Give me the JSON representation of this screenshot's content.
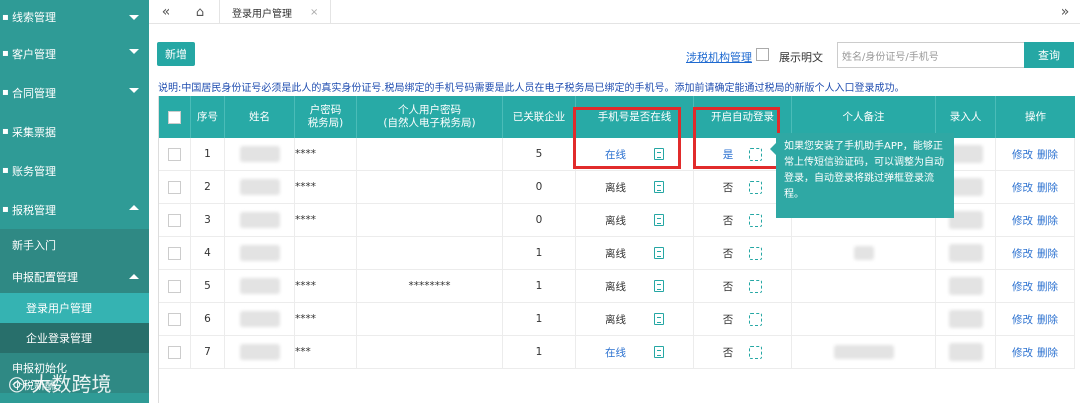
{
  "sidebar": {
    "items": [
      {
        "label": "线索管理",
        "icon": "folder-icon"
      },
      {
        "label": "客户管理",
        "icon": "user-icon"
      },
      {
        "label": "合同管理",
        "icon": "contract-icon"
      },
      {
        "label": "采集票据",
        "icon": "receipt-icon"
      },
      {
        "label": "账务管理",
        "icon": "ledger-icon"
      },
      {
        "label": "报税管理",
        "icon": "tax-icon"
      }
    ],
    "sub": {
      "newbie": "新手入门",
      "declare_config": "申报配置管理"
    },
    "sub3": {
      "login_user": "登录用户管理",
      "enterprise_login": "企业登录管理"
    },
    "more": {
      "init": "申报初始化",
      "new_tax": "个税新酬"
    },
    "watermark": "大数跨境"
  },
  "topbar": {
    "tab_label": "登录用户管理",
    "tab_close": "×"
  },
  "toolbar": {
    "new_label": "新增",
    "tax_org_link": "涉税机构管理",
    "show_plain": "展示明文",
    "search_placeholder": "姓名/身份证号/手机号",
    "query_label": "查询"
  },
  "notice": "说明:中国居民身份证号必须是此人的真实身份证号.税局绑定的手机号码需要是此人员在电子税务局已绑定的手机号。添加前请确定能通过税局的新版个人入口登录成功。",
  "table": {
    "headers": {
      "seq": "序号",
      "name": "姓名",
      "pwd1": "户密码",
      "pwd2": "税务局)",
      "personal1": "个人用户密码",
      "personal2": "(自然人电子税务局)",
      "linked": "已关联企业",
      "phone_online": "手机号是否在线",
      "auto_login": "开启自动登录",
      "remark": "个人备注",
      "entry": "录入人",
      "ops": "操作"
    },
    "rows": [
      {
        "seq": "1",
        "pwd": "****",
        "personal_pwd": "",
        "linked": "5",
        "online": "在线",
        "online_link": true,
        "auto": "是",
        "auto_link": true
      },
      {
        "seq": "2",
        "pwd": "****",
        "personal_pwd": "",
        "linked": "0",
        "online": "离线",
        "online_link": false,
        "auto": "否",
        "auto_link": false
      },
      {
        "seq": "3",
        "pwd": "****",
        "personal_pwd": "",
        "linked": "0",
        "online": "离线",
        "online_link": false,
        "auto": "否",
        "auto_link": false
      },
      {
        "seq": "4",
        "pwd": "",
        "personal_pwd": "",
        "linked": "1",
        "online": "离线",
        "online_link": false,
        "auto": "否",
        "auto_link": false
      },
      {
        "seq": "5",
        "pwd": "****",
        "personal_pwd": "********",
        "linked": "1",
        "online": "离线",
        "online_link": false,
        "auto": "否",
        "auto_link": false
      },
      {
        "seq": "6",
        "pwd": "****",
        "personal_pwd": "",
        "linked": "1",
        "online": "离线",
        "online_link": false,
        "auto": "否",
        "auto_link": false
      },
      {
        "seq": "7",
        "pwd": "***",
        "personal_pwd": "",
        "linked": "1",
        "online": "在线",
        "online_link": true,
        "auto": "否",
        "auto_link": false
      }
    ],
    "op_edit": "修改",
    "op_delete": "删除"
  },
  "tooltip": "如果您安装了手机助手APP，能够正常上传短信验证码，可以调整为自动登录，自动登录将跳过弹框登录流程。",
  "colors": {
    "accent": "#28aaa6",
    "sidebar": "#2f9b96",
    "link": "#2b71d0",
    "highlight": "#e12b2b"
  }
}
